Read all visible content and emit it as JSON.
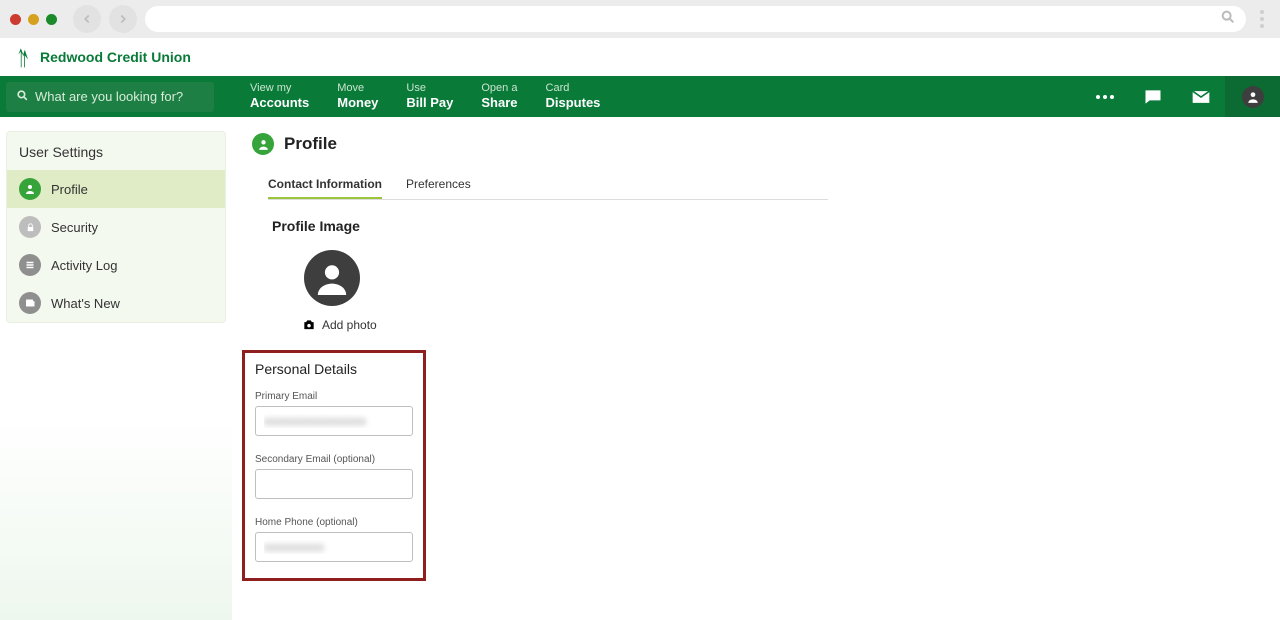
{
  "brand": {
    "name": "Redwood Credit Union"
  },
  "search": {
    "placeholder": "What are you looking for?"
  },
  "nav": {
    "items": [
      {
        "top": "View my",
        "bot": "Accounts"
      },
      {
        "top": "Move",
        "bot": "Money"
      },
      {
        "top": "Use",
        "bot": "Bill Pay"
      },
      {
        "top": "Open a",
        "bot": "Share"
      },
      {
        "top": "Card",
        "bot": "Disputes"
      }
    ]
  },
  "sidebar": {
    "title": "User Settings",
    "items": [
      {
        "label": "Profile"
      },
      {
        "label": "Security"
      },
      {
        "label": "Activity Log"
      },
      {
        "label": "What's New"
      }
    ]
  },
  "page": {
    "title": "Profile"
  },
  "tabs": [
    {
      "label": "Contact Information"
    },
    {
      "label": "Preferences"
    }
  ],
  "profile_image": {
    "heading": "Profile Image",
    "add_photo": "Add photo"
  },
  "personal_details": {
    "heading": "Personal Details",
    "fields": {
      "primary_email": {
        "label": "Primary Email",
        "value": "xxxxxxxxxxxxxxxxx"
      },
      "secondary_email": {
        "label": "Secondary Email (optional)",
        "value": ""
      },
      "home_phone": {
        "label": "Home Phone (optional)",
        "value": "xxxxxxxxxx"
      }
    }
  }
}
